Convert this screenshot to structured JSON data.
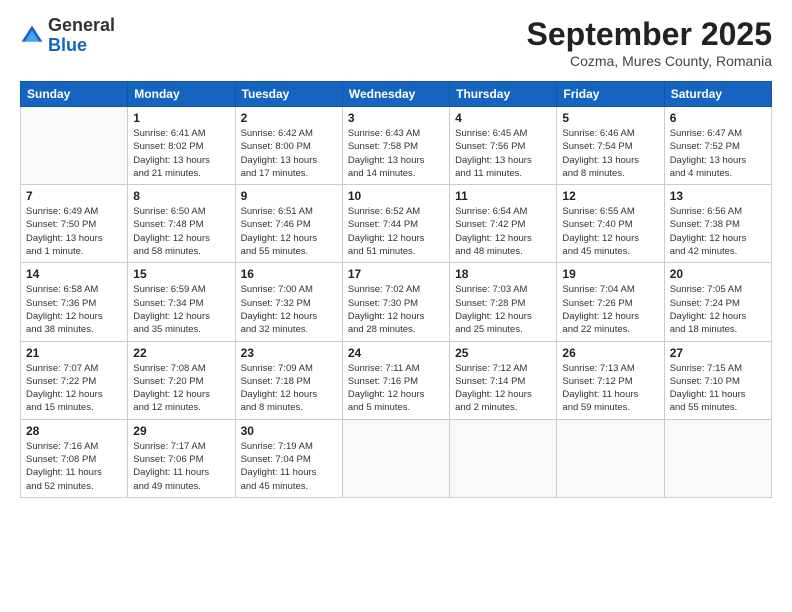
{
  "logo": {
    "general": "General",
    "blue": "Blue"
  },
  "header": {
    "month": "September 2025",
    "location": "Cozma, Mures County, Romania"
  },
  "days_of_week": [
    "Sunday",
    "Monday",
    "Tuesday",
    "Wednesday",
    "Thursday",
    "Friday",
    "Saturday"
  ],
  "weeks": [
    [
      {
        "day": "",
        "info": ""
      },
      {
        "day": "1",
        "info": "Sunrise: 6:41 AM\nSunset: 8:02 PM\nDaylight: 13 hours\nand 21 minutes."
      },
      {
        "day": "2",
        "info": "Sunrise: 6:42 AM\nSunset: 8:00 PM\nDaylight: 13 hours\nand 17 minutes."
      },
      {
        "day": "3",
        "info": "Sunrise: 6:43 AM\nSunset: 7:58 PM\nDaylight: 13 hours\nand 14 minutes."
      },
      {
        "day": "4",
        "info": "Sunrise: 6:45 AM\nSunset: 7:56 PM\nDaylight: 13 hours\nand 11 minutes."
      },
      {
        "day": "5",
        "info": "Sunrise: 6:46 AM\nSunset: 7:54 PM\nDaylight: 13 hours\nand 8 minutes."
      },
      {
        "day": "6",
        "info": "Sunrise: 6:47 AM\nSunset: 7:52 PM\nDaylight: 13 hours\nand 4 minutes."
      }
    ],
    [
      {
        "day": "7",
        "info": "Sunrise: 6:49 AM\nSunset: 7:50 PM\nDaylight: 13 hours\nand 1 minute."
      },
      {
        "day": "8",
        "info": "Sunrise: 6:50 AM\nSunset: 7:48 PM\nDaylight: 12 hours\nand 58 minutes."
      },
      {
        "day": "9",
        "info": "Sunrise: 6:51 AM\nSunset: 7:46 PM\nDaylight: 12 hours\nand 55 minutes."
      },
      {
        "day": "10",
        "info": "Sunrise: 6:52 AM\nSunset: 7:44 PM\nDaylight: 12 hours\nand 51 minutes."
      },
      {
        "day": "11",
        "info": "Sunrise: 6:54 AM\nSunset: 7:42 PM\nDaylight: 12 hours\nand 48 minutes."
      },
      {
        "day": "12",
        "info": "Sunrise: 6:55 AM\nSunset: 7:40 PM\nDaylight: 12 hours\nand 45 minutes."
      },
      {
        "day": "13",
        "info": "Sunrise: 6:56 AM\nSunset: 7:38 PM\nDaylight: 12 hours\nand 42 minutes."
      }
    ],
    [
      {
        "day": "14",
        "info": "Sunrise: 6:58 AM\nSunset: 7:36 PM\nDaylight: 12 hours\nand 38 minutes."
      },
      {
        "day": "15",
        "info": "Sunrise: 6:59 AM\nSunset: 7:34 PM\nDaylight: 12 hours\nand 35 minutes."
      },
      {
        "day": "16",
        "info": "Sunrise: 7:00 AM\nSunset: 7:32 PM\nDaylight: 12 hours\nand 32 minutes."
      },
      {
        "day": "17",
        "info": "Sunrise: 7:02 AM\nSunset: 7:30 PM\nDaylight: 12 hours\nand 28 minutes."
      },
      {
        "day": "18",
        "info": "Sunrise: 7:03 AM\nSunset: 7:28 PM\nDaylight: 12 hours\nand 25 minutes."
      },
      {
        "day": "19",
        "info": "Sunrise: 7:04 AM\nSunset: 7:26 PM\nDaylight: 12 hours\nand 22 minutes."
      },
      {
        "day": "20",
        "info": "Sunrise: 7:05 AM\nSunset: 7:24 PM\nDaylight: 12 hours\nand 18 minutes."
      }
    ],
    [
      {
        "day": "21",
        "info": "Sunrise: 7:07 AM\nSunset: 7:22 PM\nDaylight: 12 hours\nand 15 minutes."
      },
      {
        "day": "22",
        "info": "Sunrise: 7:08 AM\nSunset: 7:20 PM\nDaylight: 12 hours\nand 12 minutes."
      },
      {
        "day": "23",
        "info": "Sunrise: 7:09 AM\nSunset: 7:18 PM\nDaylight: 12 hours\nand 8 minutes."
      },
      {
        "day": "24",
        "info": "Sunrise: 7:11 AM\nSunset: 7:16 PM\nDaylight: 12 hours\nand 5 minutes."
      },
      {
        "day": "25",
        "info": "Sunrise: 7:12 AM\nSunset: 7:14 PM\nDaylight: 12 hours\nand 2 minutes."
      },
      {
        "day": "26",
        "info": "Sunrise: 7:13 AM\nSunset: 7:12 PM\nDaylight: 11 hours\nand 59 minutes."
      },
      {
        "day": "27",
        "info": "Sunrise: 7:15 AM\nSunset: 7:10 PM\nDaylight: 11 hours\nand 55 minutes."
      }
    ],
    [
      {
        "day": "28",
        "info": "Sunrise: 7:16 AM\nSunset: 7:08 PM\nDaylight: 11 hours\nand 52 minutes."
      },
      {
        "day": "29",
        "info": "Sunrise: 7:17 AM\nSunset: 7:06 PM\nDaylight: 11 hours\nand 49 minutes."
      },
      {
        "day": "30",
        "info": "Sunrise: 7:19 AM\nSunset: 7:04 PM\nDaylight: 11 hours\nand 45 minutes."
      },
      {
        "day": "",
        "info": ""
      },
      {
        "day": "",
        "info": ""
      },
      {
        "day": "",
        "info": ""
      },
      {
        "day": "",
        "info": ""
      }
    ]
  ]
}
